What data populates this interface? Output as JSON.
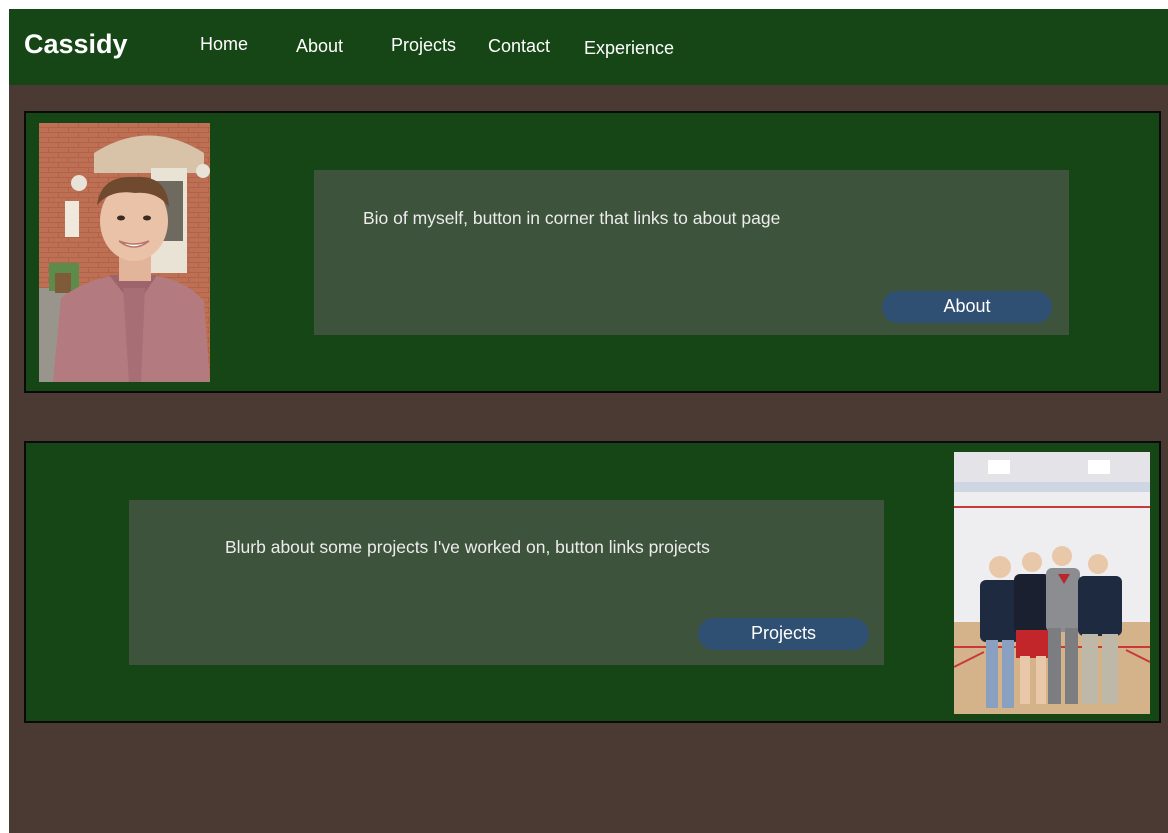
{
  "nav": {
    "brand": "Cassidy",
    "links": [
      "Home",
      "About",
      "Projects",
      "Contact",
      "Experience"
    ]
  },
  "bio_section": {
    "photo_icon": "portrait-photo",
    "text": "Bio of myself, button in corner that links to about page",
    "button_label": "About"
  },
  "projects_section": {
    "photo_icon": "group-photo-squash-court",
    "text": "Blurb about some projects I've worked on, button links projects",
    "button_label": "Projects"
  },
  "colors": {
    "nav_bg": "#164615",
    "page_bg": "#4a3a33",
    "panel_bg": "#3d533c",
    "button_bg": "#2f4f73"
  }
}
